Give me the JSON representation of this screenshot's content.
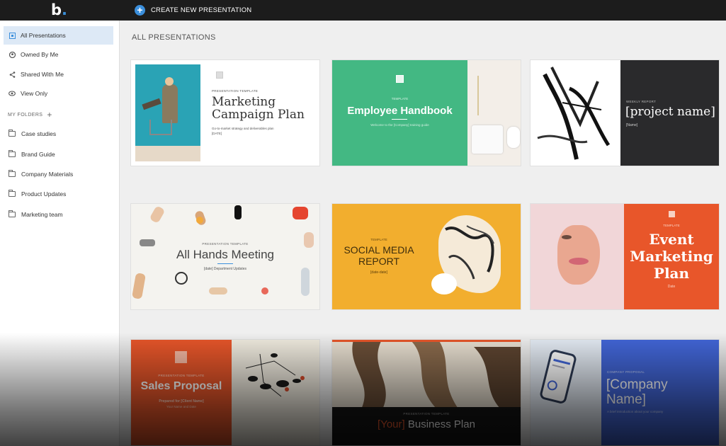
{
  "topbar": {
    "logo": "b",
    "logo_dot": ".",
    "create_label": "CREATE NEW PRESENTATION"
  },
  "sidebar": {
    "items": [
      {
        "label": "All Presentations",
        "icon": "presentation-icon"
      },
      {
        "label": "Owned By Me",
        "icon": "user-icon"
      },
      {
        "label": "Shared With Me",
        "icon": "share-icon"
      },
      {
        "label": "View Only",
        "icon": "eye-icon"
      }
    ],
    "folders_heading": "MY FOLDERS",
    "folders": [
      "Case studies",
      "Brand Guide",
      "Company Materials",
      "Product Updates",
      "Marketing team"
    ]
  },
  "main": {
    "title": "ALL PRESENTATIONS",
    "cards": [
      {
        "eyebrow": "PRESENTATION TEMPLATE",
        "title_line1": "Marketing",
        "title_line2": "Campaign Plan",
        "subtitle": "Go-to-market strategy and deliverables plan",
        "date": "[DATE]"
      },
      {
        "eyebrow": "TEMPLATE",
        "title": "Employee Handbook",
        "subtitle": "Welcome to the [Company] training guide"
      },
      {
        "eyebrow": "WEEKLY REPORT",
        "title": "[project name]",
        "subtitle": "[Name]"
      },
      {
        "eyebrow": "PRESENTATION TEMPLATE",
        "title": "All Hands Meeting",
        "subtitle": "[date] Department Updates"
      },
      {
        "eyebrow": "TEMPLATE",
        "title_line1": "SOCIAL MEDIA",
        "title_line2": "REPORT",
        "subtitle": "[date-date]"
      },
      {
        "eyebrow": "TEMPLATE",
        "title_line1": "Event",
        "title_line2": "Marketing",
        "title_line3": "Plan",
        "subtitle": "Date"
      },
      {
        "eyebrow": "PRESENTATION TEMPLATE",
        "title": "Sales Proposal",
        "subtitle": "Prepared for [Client Name]",
        "note": "Your Name and Date"
      },
      {
        "eyebrow": "PRESENTATION TEMPLATE",
        "title_accent": "[Your]",
        "title_rest": " Business Plan"
      },
      {
        "eyebrow": "COMPANY PROPOSAL",
        "title_line1": "[Company",
        "title_line2": "Name]",
        "subtitle": "A brief introduction about your company"
      }
    ]
  },
  "colors": {
    "topbar": "#1c1c1c",
    "accent": "#3b8fdc",
    "green": "#43b883",
    "orange": "#e8562a",
    "yellow": "#f2ae2e",
    "blue": "#4266d8"
  }
}
